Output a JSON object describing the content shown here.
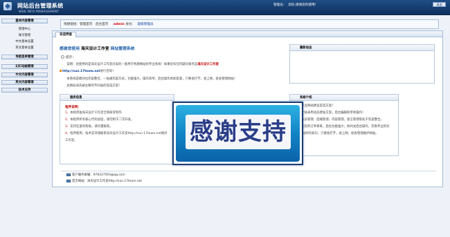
{
  "header": {
    "title": "网站后台管理系统",
    "subtitle": "WEB INFO MANAGEMENT",
    "admin_text": "管理员：",
    "welcome_text": "您好,感谢您的使用!",
    "logout_label": "退出"
  },
  "sidebar": {
    "sections": [
      {
        "label": "基本内容管理"
      },
      {
        "label": "导航菜单管理"
      },
      {
        "label": "幻灯动画管理"
      },
      {
        "label": "中文内容管理"
      },
      {
        "label": "英文内容管理"
      },
      {
        "label": "技术支持"
      }
    ],
    "items": [
      {
        "label": "管理中心"
      },
      {
        "label": "账号管理"
      },
      {
        "label": "中文基本设置"
      },
      {
        "label": "英文基本设置"
      }
    ]
  },
  "nav": {
    "prefix": "快捷链接：管理首页　后台首页",
    "user": "admin",
    "identity": "身份：",
    "role": "超级管理员"
  },
  "panel": {
    "tab_label": "欢迎界面",
    "welcome_pre": "感谢您使用",
    "welcome_bold": "海天设计工作室",
    "welcome_post": "网站管理系统",
    "tip_label": "提示：",
    "para1_a": "　说明：您使用的是海天设计工作室开发的一套用于构建网站的专业系统！如果您有任何疑问请点击",
    "para1_red": "海天设计工作室",
    "para2_a": "http://sun.17team.net",
    "para2_b": "进行咨询！",
    "para3": "　本系统是模块化完美整合，一站通完美方式，功能强大，操作简单，后台操作易如反掌，只要会打字，会上网，就会管理网站！",
    "para4": "　此网站海浩被主要的不同站的首选方案！"
  },
  "news_box": {
    "title": "最新动态"
  },
  "help_box": {
    "title": "服务信息",
    "program_title": "程序说明：",
    "lines": [
      {
        "n": "1、",
        "text": "本程序由海天设计工作室全新研究制作"
      },
      {
        "n": "2、",
        "text": "本程序所有核心代码加密，请勿用于二次开发。"
      },
      {
        "n": "3、",
        "text": "支持任意的帮助，请尽量联系。"
      },
      {
        "n": "4、",
        "text": "程序使用，技术支持请联系海天设计工作室http://sun.17team.net网开"
      },
      {
        "n": "",
        "text": "工作室。"
      }
    ]
  },
  "sys_box": {
    "title": "系统介绍",
    "lines": [
      {
        "n": "1、",
        "text": "专业网站建设首选方案！"
      },
      {
        "n": "2、",
        "text": "全站采用动态建站方案，后台编辑简单易操作！"
      },
      {
        "n": "3、",
        "text": "会员管理、后端管理、内容管理，留言管理等处于完美整合。"
      },
      {
        "n": "4、",
        "text": "帮您的订单将来，后台功能强大，依托式后台操作，完爽专业的对"
      },
      {
        "n": "",
        "text": "　网站制作知识，只要会打字，会上网，就会管理维护网站。"
      }
    ]
  },
  "footer": {
    "email_label": "客户服务邮箱：",
    "email": "978337593@qq.com",
    "site_label": "官方网站：",
    "site": "海天设计工作室http://sun.17team.net"
  },
  "overlay": {
    "text": "感谢支持"
  }
}
